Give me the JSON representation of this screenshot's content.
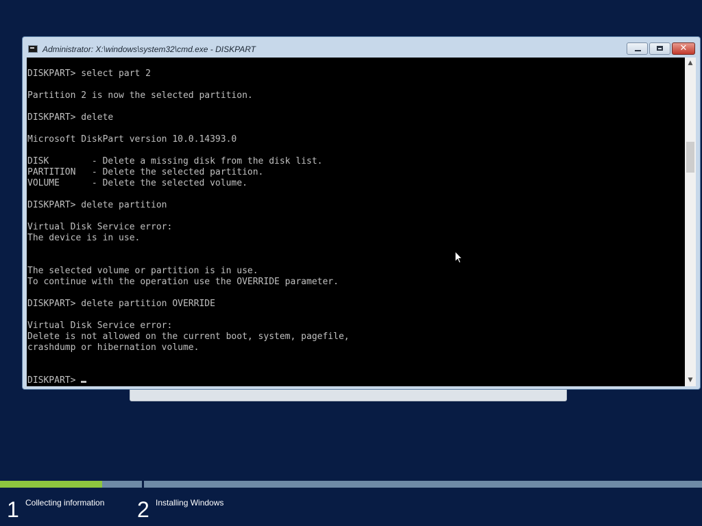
{
  "window": {
    "title": "Administrator: X:\\windows\\system32\\cmd.exe - DISKPART",
    "minimize_icon": "minimize-icon",
    "maximize_icon": "maximize-icon",
    "close_glyph": "✕"
  },
  "console": {
    "lines": [
      "DISKPART> select part 2",
      "",
      "Partition 2 is now the selected partition.",
      "",
      "DISKPART> delete",
      "",
      "Microsoft DiskPart version 10.0.14393.0",
      "",
      "DISK        - Delete a missing disk from the disk list.",
      "PARTITION   - Delete the selected partition.",
      "VOLUME      - Delete the selected volume.",
      "",
      "DISKPART> delete partition",
      "",
      "Virtual Disk Service error:",
      "The device is in use.",
      "",
      "",
      "The selected volume or partition is in use.",
      "To continue with the operation use the OVERRIDE parameter.",
      "",
      "DISKPART> delete partition OVERRIDE",
      "",
      "Virtual Disk Service error:",
      "Delete is not allowed on the current boot, system, pagefile,",
      "crashdump or hibernation volume.",
      "",
      ""
    ],
    "prompt": "DISKPART> ",
    "text_color": "#c0c0c0",
    "background": "#000000"
  },
  "scrollbar": {
    "up_glyph": "▲",
    "down_glyph": "▼"
  },
  "setup_progress": {
    "step1_progress": 0.72,
    "accent": "#8dc63f",
    "steps": [
      {
        "number": "1",
        "label": "Collecting information"
      },
      {
        "number": "2",
        "label": "Installing Windows"
      }
    ]
  }
}
